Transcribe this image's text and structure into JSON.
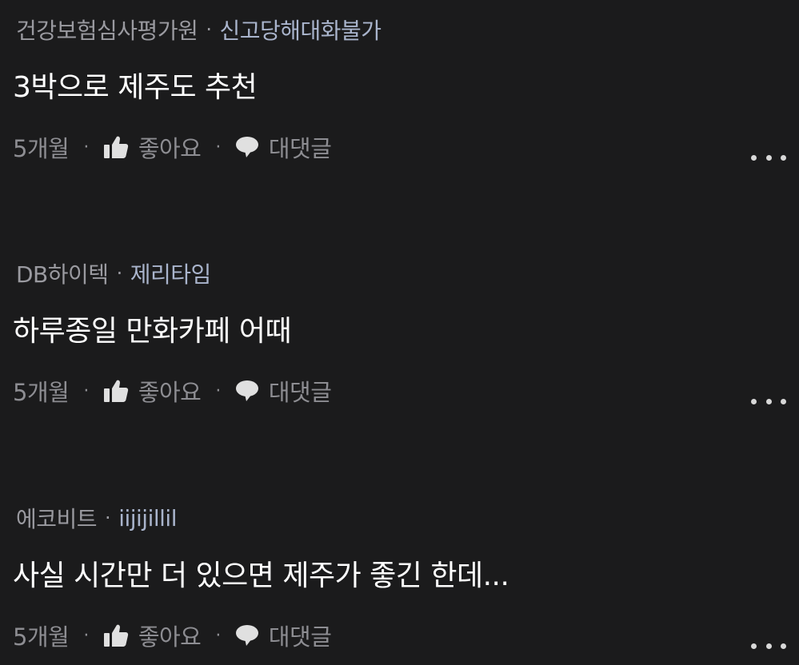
{
  "separator": "·",
  "comments": [
    {
      "company": "건강보험심사평가원",
      "nickname": "신고당해대화불가",
      "text": "3박으로 제주도 추천",
      "time": "5개월",
      "like_label": "좋아요",
      "reply_label": "대댓글"
    },
    {
      "company": "DB하이텍",
      "nickname": "제리타임",
      "text": "하루종일 만화카페 어때",
      "time": "5개월",
      "like_label": "좋아요",
      "reply_label": "대댓글"
    },
    {
      "company": "에코비트",
      "nickname": "iijijillil",
      "text": "사실 시간만 더 있으면 제주가 좋긴 한데...",
      "time": "5개월",
      "like_label": "좋아요",
      "reply_label": "대댓글"
    }
  ]
}
